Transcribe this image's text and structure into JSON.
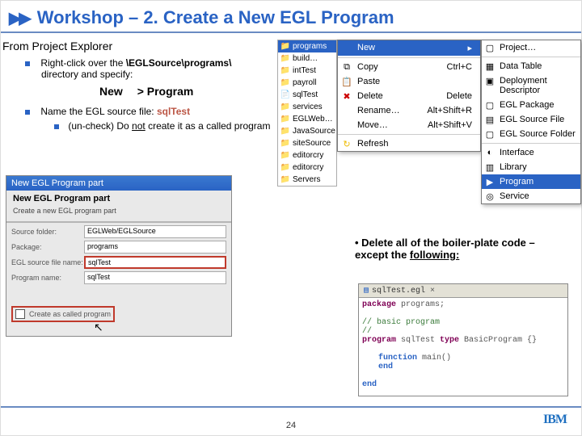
{
  "title": "Workshop – 2. Create a New EGL Program",
  "instr_head": "From Project Explorer",
  "bullet1_a": "Right-click over the ",
  "bullet1_path": "\\EGLSource\\programs\\",
  "bullet1_b": " directory and specify:",
  "new_lbl": "New",
  "prog_lbl": "> Program",
  "bullet2_a": "Name the EGL source file: ",
  "bullet2_file": "sqlTest",
  "sub_a": "(un-check)  Do ",
  "sub_not": "not",
  "sub_b": " create it as a called program",
  "wiz": {
    "title": "New EGL Program part",
    "heading": "New EGL Program part",
    "desc": "Create a new EGL program part",
    "f_srcfolder_lbl": "Source folder:",
    "f_srcfolder_val": "EGLWeb/EGLSource",
    "f_pkg_lbl": "Package:",
    "f_pkg_val": "programs",
    "f_srcfile_lbl": "EGL source file name:",
    "f_srcfile_val": "sqlTest",
    "f_prog_lbl": "Program name:",
    "f_prog_val": "sqlTest",
    "chk_lbl": "Create as called program"
  },
  "ctx_left": {
    "i0": "programs",
    "i1": "build…",
    "i2": "intTest",
    "i3": "payroll",
    "i4": "sqlTest",
    "i5": "services",
    "i6": "EGLWeb…",
    "i7": "JavaSource",
    "i8": "siteSource",
    "i9": "editorcry",
    "i10": "editorcry",
    "i11": "Servers"
  },
  "ctx": {
    "new": "New",
    "copy": "Copy",
    "copy_sc": "Ctrl+C",
    "paste": "Paste",
    "delete": "Delete",
    "delete_sc": "Delete",
    "rename": "Rename…",
    "move": "Move…",
    "sc3": "Alt+Shift+R",
    "sc4": "Alt+Shift+V",
    "refresh": "Refresh"
  },
  "submenu": {
    "project": "Project…",
    "datatable": "Data Table",
    "depdesc": "Deployment Descriptor",
    "eglpkg": "EGL Package",
    "eglsrc": "EGL Source File",
    "eglsrcf": "EGL Source Folder",
    "iface": "Interface",
    "library": "Library",
    "program": "Program",
    "service": "Service"
  },
  "callout_a": "• Delete all of the boiler-plate code – except the ",
  "callout_b": "following:",
  "editor": {
    "tab": "sqlTest.egl",
    "l1a": "package ",
    "l1b": "programs;",
    "l2": "// basic program",
    "l3": "//",
    "l4a": "program ",
    "l4b": "sqlTest ",
    "l4c": "type ",
    "l4d": "BasicProgram {}",
    "l5a": "function ",
    "l5b": "main()",
    "l6": "end",
    "l7": "end"
  },
  "page": "24",
  "ibm": "IBM"
}
